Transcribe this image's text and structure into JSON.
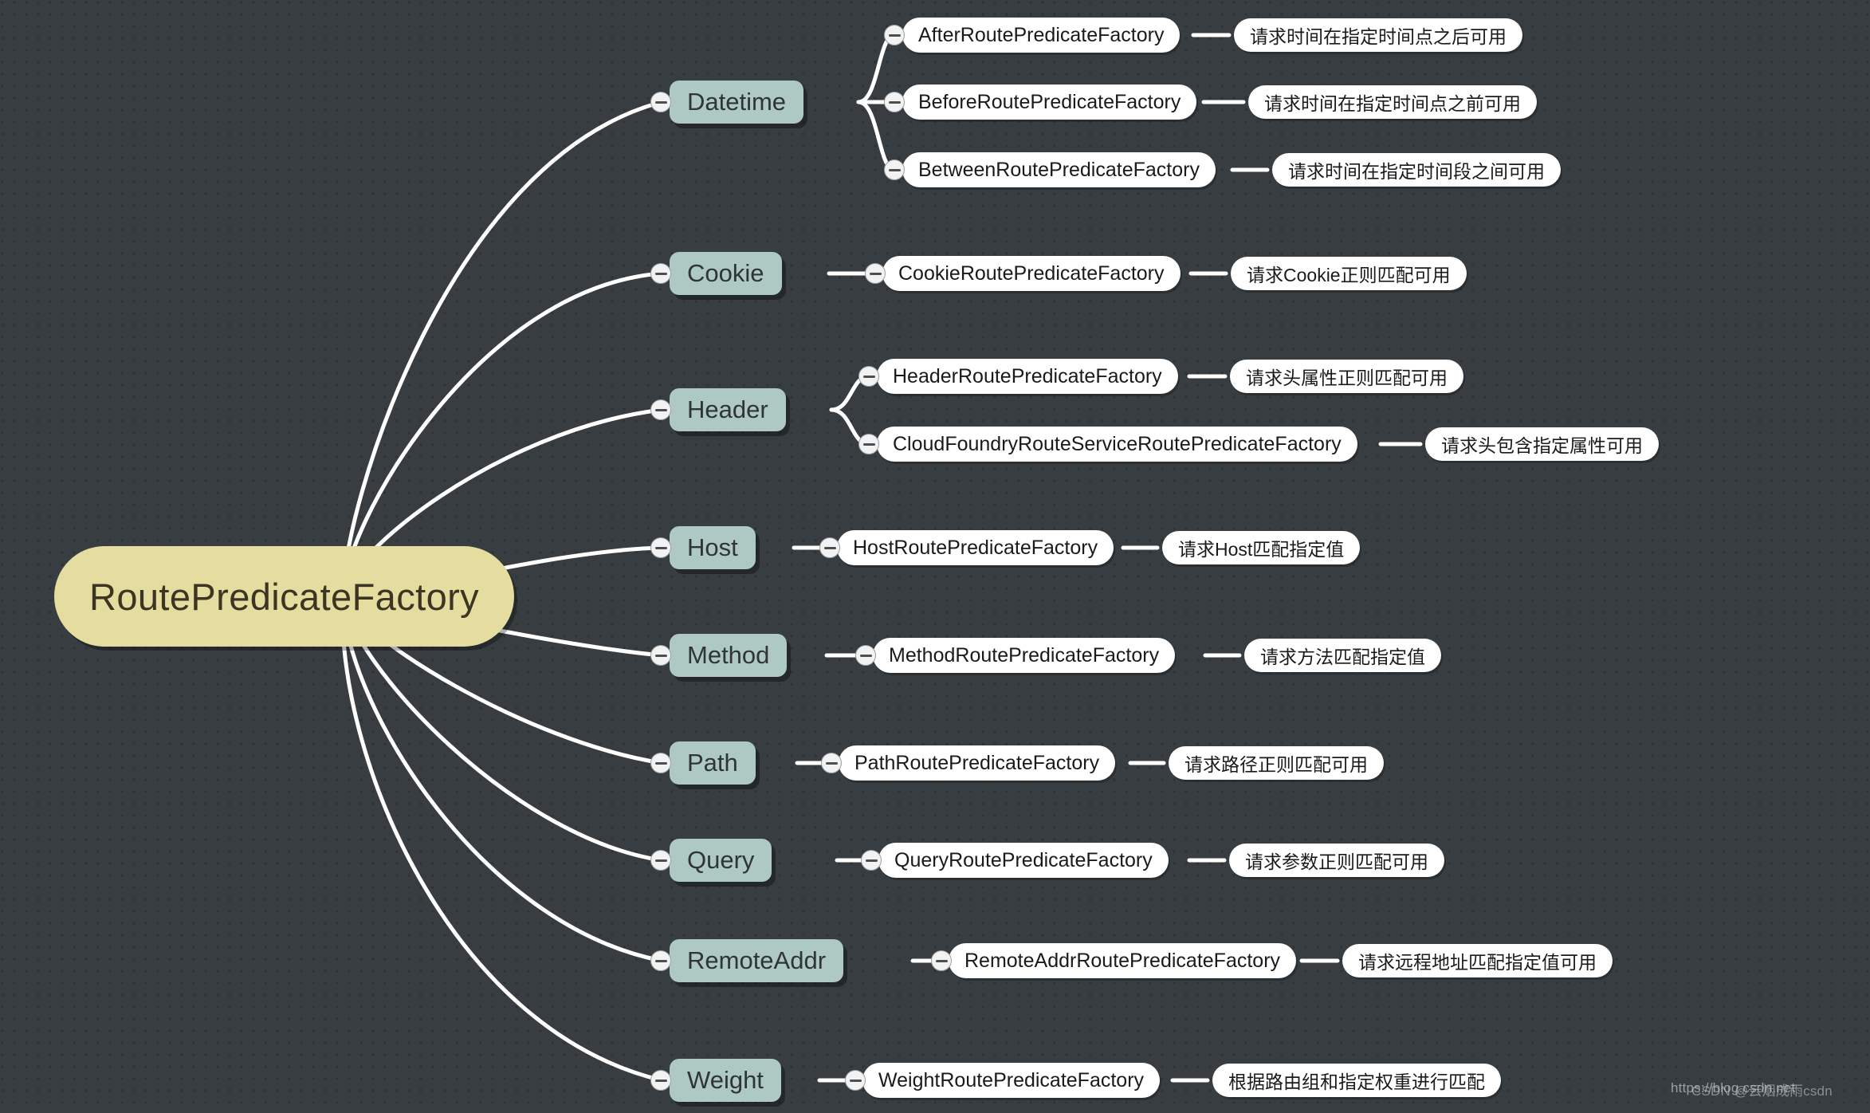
{
  "diagram": {
    "type": "mindmap",
    "title": "RoutePredicateFactory",
    "background_color": "#383d41",
    "root_color": "#e5dd9f",
    "branch_color": "#aec9c3",
    "leaf_color": "#ffffff",
    "edge_color": "#ffffff"
  },
  "root": {
    "label": "RoutePredicateFactory"
  },
  "branches": [
    {
      "label": "Datetime",
      "children": [
        {
          "label": "AfterRoutePredicateFactory",
          "desc": "请求时间在指定时间点之后可用"
        },
        {
          "label": "BeforeRoutePredicateFactory",
          "desc": "请求时间在指定时间点之前可用"
        },
        {
          "label": "BetweenRoutePredicateFactory",
          "desc": "请求时间在指定时间段之间可用"
        }
      ]
    },
    {
      "label": "Cookie",
      "children": [
        {
          "label": "CookieRoutePredicateFactory",
          "desc": "请求Cookie正则匹配可用"
        }
      ]
    },
    {
      "label": "Header",
      "children": [
        {
          "label": "HeaderRoutePredicateFactory",
          "desc": "请求头属性正则匹配可用"
        },
        {
          "label": "CloudFoundryRouteServiceRoutePredicateFactory",
          "desc": "请求头包含指定属性可用"
        }
      ]
    },
    {
      "label": "Host",
      "children": [
        {
          "label": "HostRoutePredicateFactory",
          "desc": "请求Host匹配指定值"
        }
      ]
    },
    {
      "label": "Method",
      "children": [
        {
          "label": "MethodRoutePredicateFactory",
          "desc": "请求方法匹配指定值"
        }
      ]
    },
    {
      "label": "Path",
      "children": [
        {
          "label": "PathRoutePredicateFactory",
          "desc": "请求路径正则匹配可用"
        }
      ]
    },
    {
      "label": "Query",
      "children": [
        {
          "label": "QueryRoutePredicateFactory",
          "desc": "请求参数正则匹配可用"
        }
      ]
    },
    {
      "label": "RemoteAddr",
      "children": [
        {
          "label": "RemoteAddrRoutePredicateFactory",
          "desc": "请求远程地址匹配指定值可用"
        }
      ]
    },
    {
      "label": "Weight",
      "children": [
        {
          "label": "WeightRoutePredicateFactory",
          "desc": "根据路由组和指定权重进行匹配"
        }
      ]
    }
  ],
  "watermark": {
    "line_a": "https://blog.csdn.net",
    "line_b": "CSDN @云烟成雨csdn"
  }
}
